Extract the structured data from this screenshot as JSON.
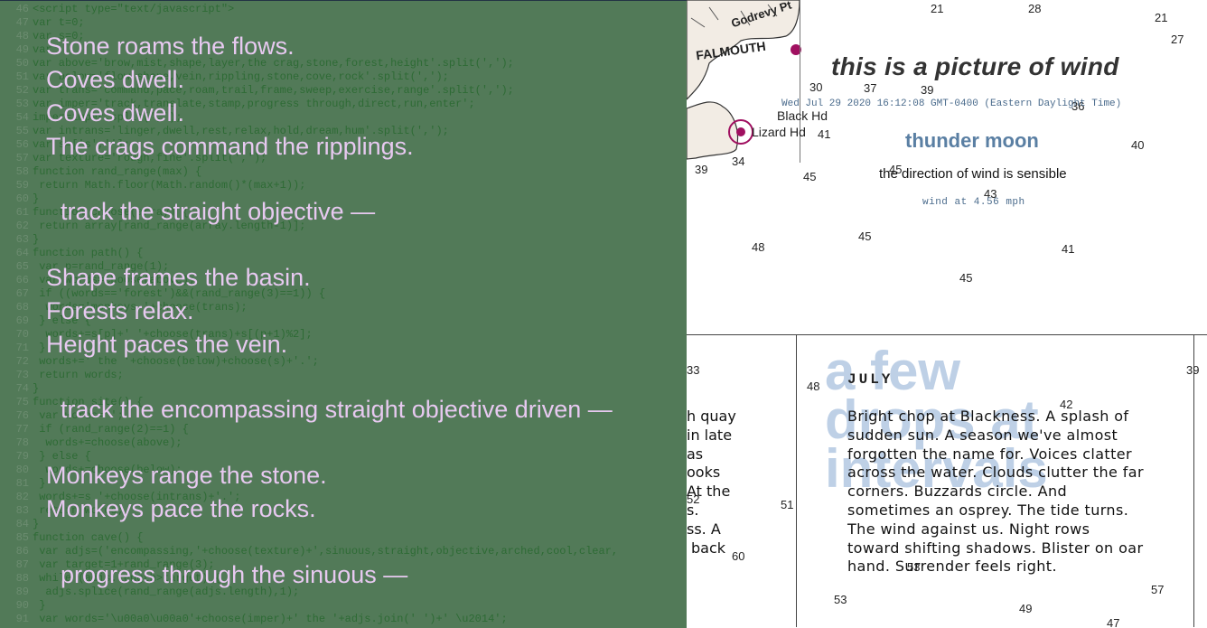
{
  "code": {
    "lines": [
      {
        "n": "46",
        "t": "<script type=\"text/javascript\">"
      },
      {
        "n": "47",
        "t": "var t=0;"
      },
      {
        "n": "48",
        "t": "var s=0;"
      },
      {
        "n": "49",
        "t": "var"
      },
      {
        "n": "50",
        "t": "var above='brow,mist,shape,layer,the crag,stone,forest,height'.split(',');"
      },
      {
        "n": "51",
        "t": "var below='flow,shape,vein,rippling,stone,cove,rock'.split(',');"
      },
      {
        "n": "52",
        "t": "var trans='command,pace,roam,trail,frame,sweep,exercise,range'.split(',');"
      },
      {
        "n": "53",
        "t": "var imper='track,translate,stamp,progress through,direct,run,enter';"
      },
      {
        "n": "54",
        "t": "imper=imper.split(',');"
      },
      {
        "n": "55",
        "t": "var intrans='linger,dwell,rest,relax,hold,dream,hum'.split(',');"
      },
      {
        "n": "56",
        "t": "var s=['s',''];"
      },
      {
        "n": "57",
        "t": "var texture='rough,fine'.split(',');"
      },
      {
        "n": "58",
        "t": "function rand_range(max) {"
      },
      {
        "n": "59",
        "t": " return Math.floor(Math.random()*(max+1));"
      },
      {
        "n": "60",
        "t": "}"
      },
      {
        "n": "61",
        "t": "function choose(array) {"
      },
      {
        "n": "62",
        "t": " return array[rand_range(array.length-1)];"
      },
      {
        "n": "63",
        "t": "}"
      },
      {
        "n": "64",
        "t": "function path() {"
      },
      {
        "n": "65",
        "t": " var p=rand_range(1);"
      },
      {
        "n": "66",
        "t": " var words=choose(above);"
      },
      {
        "n": "67",
        "t": " if ((words=='forest')&&(rand_range(3)==1)) {"
      },
      {
        "n": "68",
        "t": "  words='monkeys '+choose(trans);"
      },
      {
        "n": "69",
        "t": " } else {"
      },
      {
        "n": "70",
        "t": "  words+=s[p]+' '+choose(trans)+s[(p+1)%2];"
      },
      {
        "n": "71",
        "t": " }"
      },
      {
        "n": "72",
        "t": " words+=' the '+choose(below)+choose(s)+'.';"
      },
      {
        "n": "73",
        "t": " return words;"
      },
      {
        "n": "74",
        "t": "}"
      },
      {
        "n": "75",
        "t": "function site() {"
      },
      {
        "n": "76",
        "t": " var words='';"
      },
      {
        "n": "77",
        "t": " if (rand_range(2)==1) {"
      },
      {
        "n": "78",
        "t": "  words+=choose(above);"
      },
      {
        "n": "79",
        "t": " } else {"
      },
      {
        "n": "80",
        "t": "  words+=choose(below);"
      },
      {
        "n": "81",
        "t": " }"
      },
      {
        "n": "82",
        "t": " words+=s '+choose(intrans)+'.';"
      },
      {
        "n": "83",
        "t": " return words;"
      },
      {
        "n": "84",
        "t": "}"
      },
      {
        "n": "85",
        "t": "function cave() {"
      },
      {
        "n": "86",
        "t": " var adjs=('encompassing,'+choose(texture)+',sinuous,straight,objective,arched,cool,clear,"
      },
      {
        "n": "87",
        "t": " var target=1+rand_range(3);"
      },
      {
        "n": "88",
        "t": " while (adjs.length>target) {"
      },
      {
        "n": "89",
        "t": "  adjs.splice(rand_range(adjs.length),1);"
      },
      {
        "n": "90",
        "t": " }"
      },
      {
        "n": "91",
        "t": " var words='\\u00a0\\u00a0'+choose(imper)+' the '+adjs.join(' ')+' \\u2014';"
      }
    ]
  },
  "poem": [
    {
      "text": "Stone roams the flows.",
      "indent": false
    },
    {
      "text": "Coves dwell.",
      "indent": false
    },
    {
      "text": "Coves dwell.",
      "indent": false
    },
    {
      "text": "The crags command the ripplings.",
      "indent": false
    },
    {
      "text": "track the straight objective —",
      "indent": true
    },
    {
      "text": "Shape frames the basin.",
      "indent": false
    },
    {
      "text": "Forests relax.",
      "indent": false
    },
    {
      "text": "Height paces the vein.",
      "indent": false
    },
    {
      "text": "track the encompassing straight objective driven —",
      "indent": true
    },
    {
      "text": "Monkeys range the stone.",
      "indent": false
    },
    {
      "text": "Monkeys pace the rocks.",
      "indent": false
    },
    {
      "text": "progress through the sinuous —",
      "indent": true
    }
  ],
  "wind": {
    "title": "this is a picture of wind",
    "date": "Wed Jul 29 2020 16:12:08 GMT-0400 (Eastern Daylight Time)",
    "moon": "thunder moon",
    "sensible": "the direction of wind is sensible",
    "speed": "wind at 4.56 mph"
  },
  "july": {
    "big": "a few drops at intervals",
    "label": "JULY",
    "body": "Bright chop at Blackness. A splash of sudden sun. A season we've almost forgotten the name for. Voices clatter across the water. Clouds clutter the far corners. Buzzards circle. And sometimes an osprey. The tide turns. The wind against us. Night rows toward shifting shadows. Blister on oar hand. Surrender feels right."
  },
  "left_fragment": [
    "h quay",
    "in late",
    "as",
    "ooks",
    "At the",
    "s.",
    "ss. A",
    "back"
  ],
  "map": {
    "place_labels": [
      "FALMOUTH",
      "Black Hd",
      "Lizard Hd",
      "Godrevy Pt"
    ],
    "soundings": [
      "21",
      "28",
      "21",
      "27",
      "30",
      "37",
      "39",
      "36",
      "41",
      "40",
      "39",
      "34",
      "45",
      "45",
      "43",
      "48",
      "45",
      "41",
      "45",
      "33",
      "48",
      "42",
      "39",
      "51",
      "52",
      "60",
      "53",
      "53",
      "57",
      "49",
      "47"
    ]
  }
}
